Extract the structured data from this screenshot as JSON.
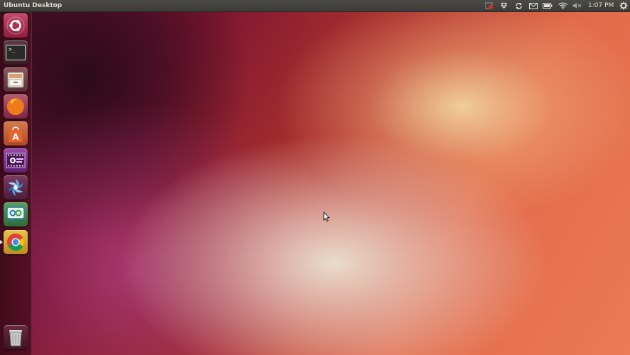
{
  "panel": {
    "title": "Ubuntu Desktop",
    "clock": "1:07 PM",
    "tray_icons": [
      "indicator-red-icon",
      "dropbox-icon",
      "sync-icon",
      "mail-icon",
      "battery-icon",
      "wifi-icon",
      "volume-muted-icon",
      "gear-icon"
    ]
  },
  "launcher": {
    "items": [
      {
        "name": "dash-home",
        "icon": "ubuntu-logo-icon"
      },
      {
        "name": "terminal",
        "icon": "terminal-icon"
      },
      {
        "name": "files",
        "icon": "file-cabinet-icon"
      },
      {
        "name": "firefox",
        "icon": "firefox-icon"
      },
      {
        "name": "software-center",
        "icon": "shopping-bag-icon"
      },
      {
        "name": "video-player",
        "icon": "film-icon"
      },
      {
        "name": "shutter",
        "icon": "aperture-icon"
      },
      {
        "name": "qq-app",
        "icon": "chat-icon"
      },
      {
        "name": "chrome",
        "icon": "chrome-icon"
      }
    ],
    "trash": {
      "name": "trash",
      "icon": "trash-icon"
    }
  },
  "terminal_glyph": ">_"
}
